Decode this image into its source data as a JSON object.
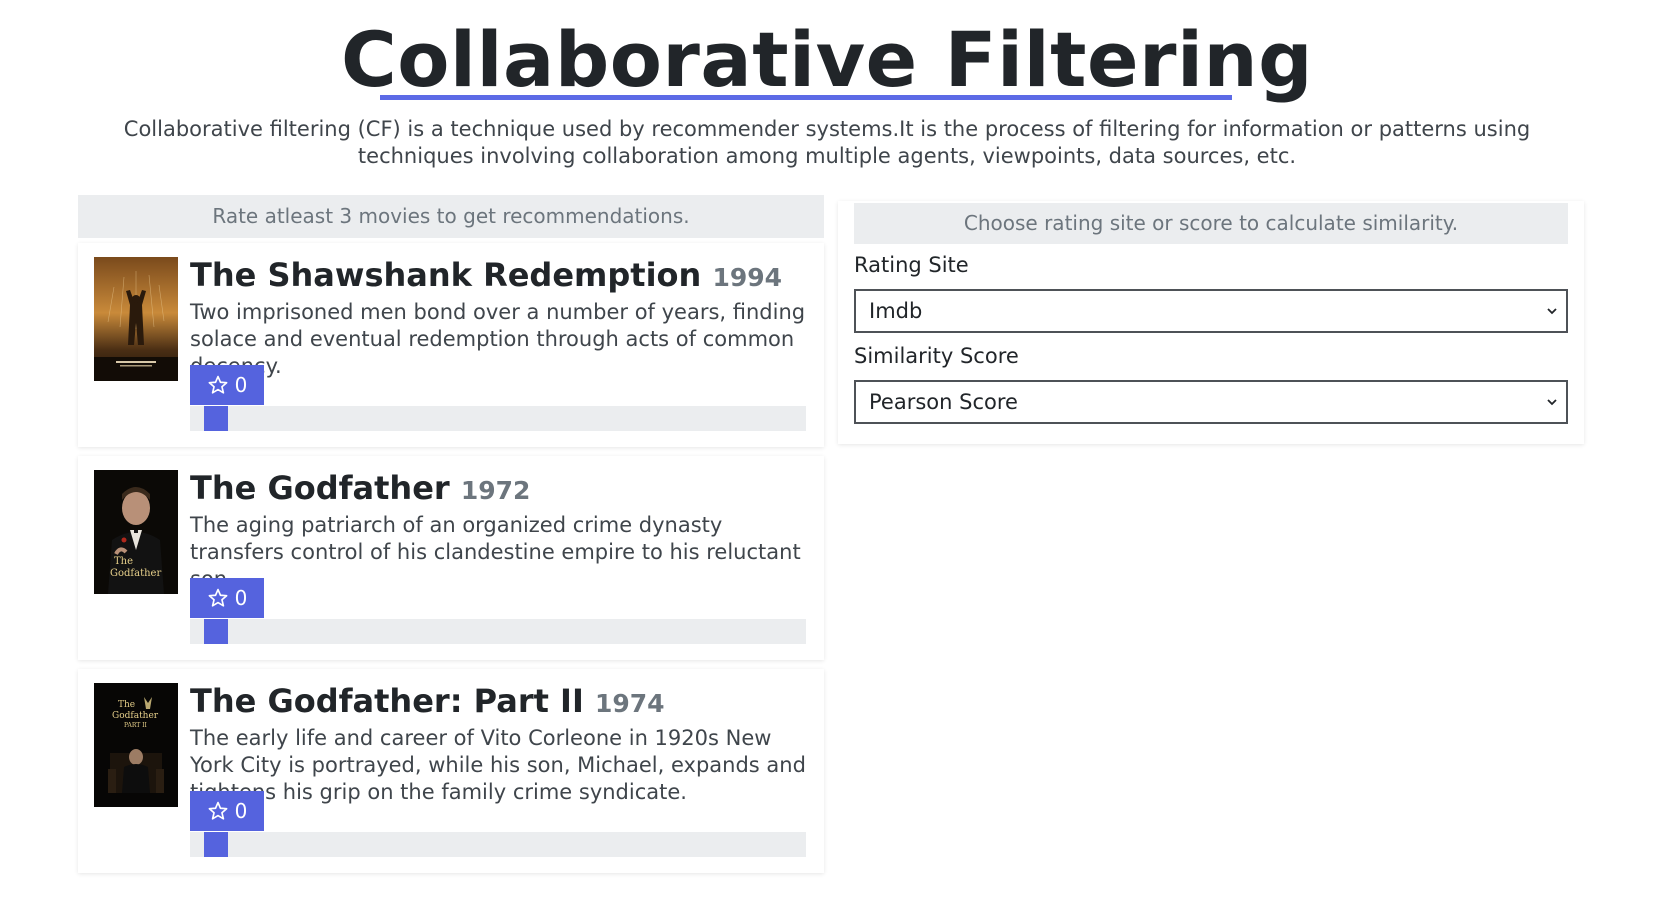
{
  "header": {
    "title": "Collaborative Filtering",
    "description": "Collaborative filtering (CF) is a technique used by recommender systems.It is the process of filtering for information or patterns using techniques involving collaboration among multiple agents, viewpoints, data sources, etc."
  },
  "movies_panel": {
    "notice": "Rate atleast 3 movies to get recommendations.",
    "movies": [
      {
        "title": "The Shawshank Redemption",
        "year": "1994",
        "description": "Two imprisoned men bond over a number of years, finding solace and eventual redemption through acts of common decency.",
        "rating": "0",
        "rating_icon": "star-outline-icon",
        "rating_level": 0
      },
      {
        "title": "The Godfather",
        "year": "1972",
        "description": "The aging patriarch of an organized crime dynasty transfers control of his clandestine empire to his reluctant son.",
        "rating": "0",
        "rating_icon": "star-outline-icon",
        "rating_level": 0
      },
      {
        "title": "The Godfather: Part II",
        "year": "1974",
        "description": "The early life and career of Vito Corleone in 1920s New York City is portrayed, while his son, Michael, expands and tightens his grip on the family crime syndicate.",
        "rating": "0",
        "rating_icon": "star-outline-icon",
        "rating_level": 0
      }
    ]
  },
  "settings_panel": {
    "notice": "Choose rating site or score to calculate similarity.",
    "rating_site": {
      "label": "Rating Site",
      "value": "Imdb"
    },
    "similarity_score": {
      "label": "Similarity Score",
      "value": "Pearson Score"
    }
  },
  "colors": {
    "accent": "#5563de",
    "title_underline": "#5c6ae6",
    "panel_bg": "#ebedef"
  }
}
